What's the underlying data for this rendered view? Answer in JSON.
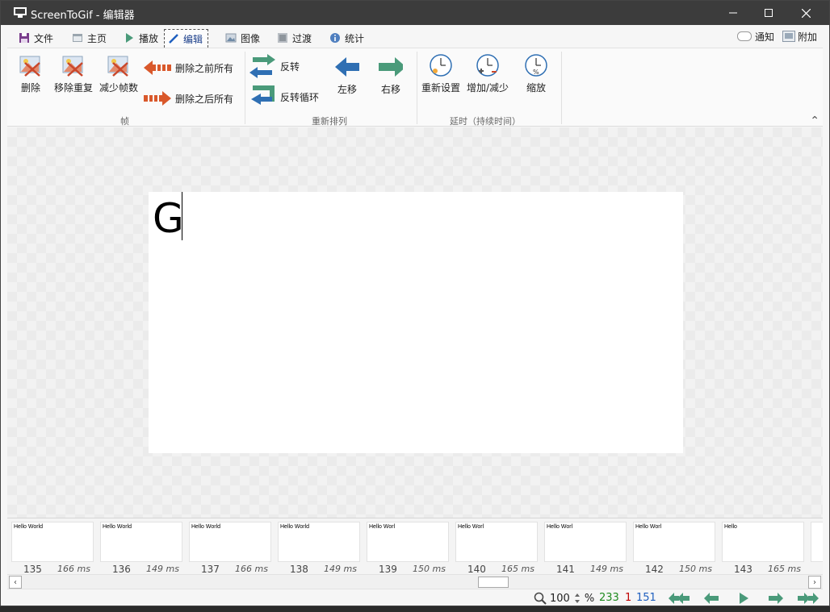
{
  "window": {
    "title": "ScreenToGif - 编辑器"
  },
  "tabs": [
    {
      "label": "文件",
      "icon": "save-icon"
    },
    {
      "label": "主页",
      "icon": "home-icon"
    },
    {
      "label": "播放",
      "icon": "play-icon"
    },
    {
      "label": "编辑",
      "icon": "pencil-icon",
      "active": true
    },
    {
      "label": "图像",
      "icon": "image-icon"
    },
    {
      "label": "过渡",
      "icon": "transition-icon"
    },
    {
      "label": "统计",
      "icon": "info-icon"
    }
  ],
  "top_right": {
    "notify_label": "通知",
    "extra_label": "附加"
  },
  "ribbon": {
    "frame_group": {
      "label": "帧",
      "delete": "删除",
      "remove_duplicates": "移除重复",
      "reduce_frames": "减少帧数",
      "delete_previous": "删除之前所有",
      "delete_next": "删除之后所有"
    },
    "reorder_group": {
      "label": "重新排列",
      "reverse": "反转",
      "yoyo": "反转循环",
      "move_left": "左移",
      "move_right": "右移"
    },
    "delay_group": {
      "label": "延时（持续时间）",
      "override": "重新设置",
      "increase_decrease": "增加/减少",
      "scale": "缩放"
    }
  },
  "canvas": {
    "text": "G"
  },
  "frames": [
    {
      "preview": "Hello World",
      "number": "135",
      "delay": "166 ms"
    },
    {
      "preview": "Hello World",
      "number": "136",
      "delay": "149 ms"
    },
    {
      "preview": "Hello World",
      "number": "137",
      "delay": "166 ms"
    },
    {
      "preview": "Hello World",
      "number": "138",
      "delay": "149 ms"
    },
    {
      "preview": "Hello Worl",
      "number": "139",
      "delay": "150 ms"
    },
    {
      "preview": "Hello Worl",
      "number": "140",
      "delay": "165 ms"
    },
    {
      "preview": "Hello Worl",
      "number": "141",
      "delay": "149 ms"
    },
    {
      "preview": "Hello Worl",
      "number": "142",
      "delay": "150 ms"
    },
    {
      "preview": "Hello",
      "number": "143",
      "delay": "165 ms"
    }
  ],
  "status": {
    "zoom": "100",
    "zoom_unit": "%",
    "total_frames": "233",
    "selected_count": "1",
    "current_frame": "151",
    "colors": {
      "total": "#1f8a1f",
      "selected": "#c00000",
      "current": "#1f5fbf",
      "nav": "#4a9a7a"
    }
  }
}
